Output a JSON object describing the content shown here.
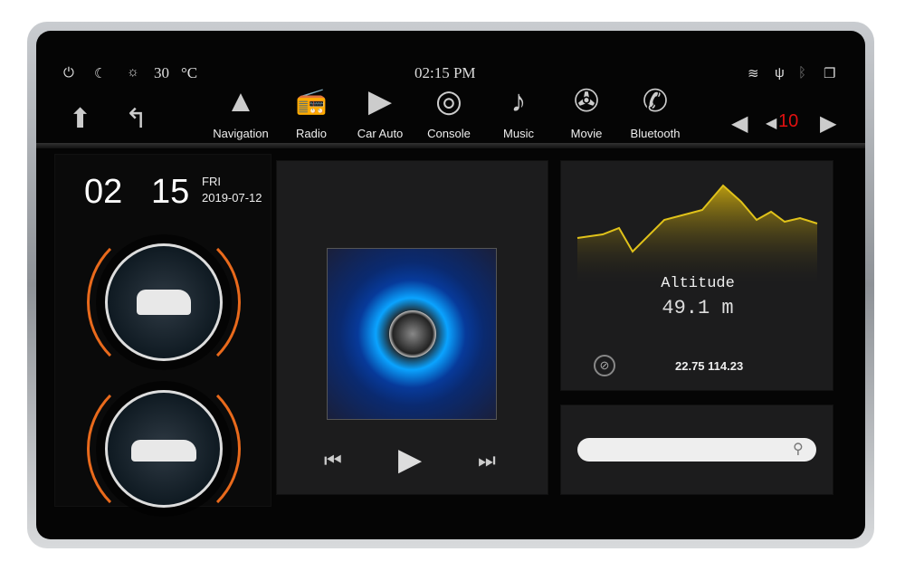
{
  "status": {
    "temperature": "30",
    "unit": "°C",
    "time": "02:15 PM",
    "icons": [
      "power-icon",
      "moon-icon",
      "brightness-icon",
      "wifi-icon",
      "usb-icon",
      "bluetooth-icon",
      "recent-apps-icon"
    ]
  },
  "nav": {
    "items": [
      {
        "label": "Navigation",
        "icon": "▲"
      },
      {
        "label": "Radio",
        "icon": "📻"
      },
      {
        "label": "Car Auto",
        "icon": "▶"
      },
      {
        "label": "Console",
        "icon": "◎"
      },
      {
        "label": "Music",
        "icon": "♪"
      },
      {
        "label": "Movie",
        "icon": "✇"
      },
      {
        "label": "Bluetooth",
        "icon": "✆"
      }
    ],
    "volume": "10"
  },
  "clock": {
    "hour": "02",
    "minute": "15",
    "day": "FRI",
    "date": "2019-07-12"
  },
  "altitude": {
    "label": "Altitude",
    "value": "49.1 m",
    "coords": "22.75 114.23",
    "accent": "#e0c21a"
  },
  "search": {
    "placeholder": ""
  }
}
